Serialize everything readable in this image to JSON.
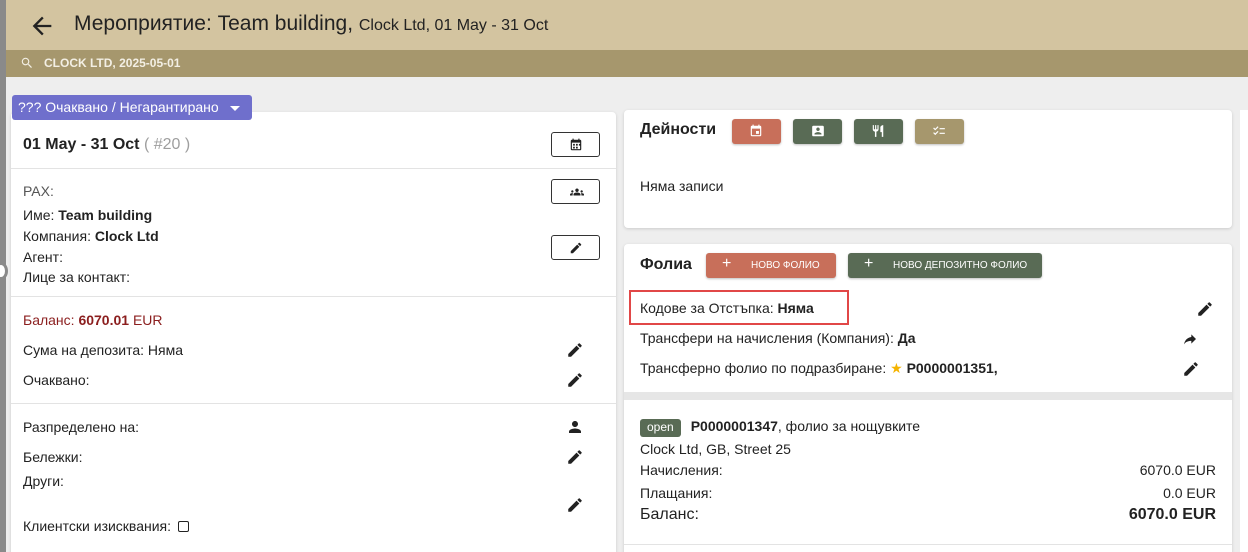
{
  "header": {
    "title": "Мероприятие: Team building,",
    "subtitle": "Clock Ltd, 01 May - 31 Oct",
    "search_text": "CLOCK LTD, 2025-05-01"
  },
  "status": {
    "label": "??? Очаквано / Негарантирано"
  },
  "event": {
    "dates": "01 May - 31 Oct",
    "number": "( #20 )",
    "pax_label": "PAX:",
    "name_label": "Име:",
    "name_value": "Team building",
    "company_label": "Компания:",
    "company_value": "Clock Ltd",
    "agent_label": "Агент:",
    "contact_label": "Лице за контакт:",
    "balance_label": "Баланс:",
    "balance_value": "6070.01",
    "balance_currency": "EUR",
    "deposit_label": "Сума на депозита:",
    "deposit_value": "Няма",
    "expected_label": "Очаквано:",
    "assigned_label": "Разпределено на:",
    "notes_label": "Бележки:",
    "others_label": "Други:",
    "requirements_label": "Клиентски изисквания:"
  },
  "activities": {
    "title": "Дейности",
    "empty_text": "Няма записи",
    "button_colors": [
      "#c86f5a",
      "#596b55",
      "#596b55",
      "#a6976d"
    ]
  },
  "folios": {
    "title": "Фолиа",
    "new_folio": "НОВО ФОЛИО",
    "new_deposit_folio": "НОВО ДЕПОЗИТНО ФОЛИО",
    "discount_codes_label": "Кодове за Отстъпка:",
    "discount_codes_value": "Няма",
    "transfers_label": "Трансфери на начисления (Компания):",
    "transfers_value": "Да",
    "default_folio_label": "Трансферно фолио по подразбиране:",
    "default_folio_value": "P0000001351,",
    "folio": {
      "status": "open",
      "number": "P0000001347",
      "description": ", фолио за нощувките",
      "address": "Clock Ltd, GB, Street 25",
      "charges_label": "Начисления:",
      "charges_value": "6070.0 EUR",
      "payments_label": "Плащания:",
      "payments_value": "0.0 EUR",
      "balance_label": "Баланс:",
      "balance_value": "6070.0 EUR"
    }
  },
  "colors": {
    "topbar": "#d3c4a0",
    "searchbar": "#a6976d",
    "status": "#6f6fcc",
    "new_folio": "#c86f5a",
    "new_deposit": "#596b55",
    "highlight": "#e14747"
  }
}
